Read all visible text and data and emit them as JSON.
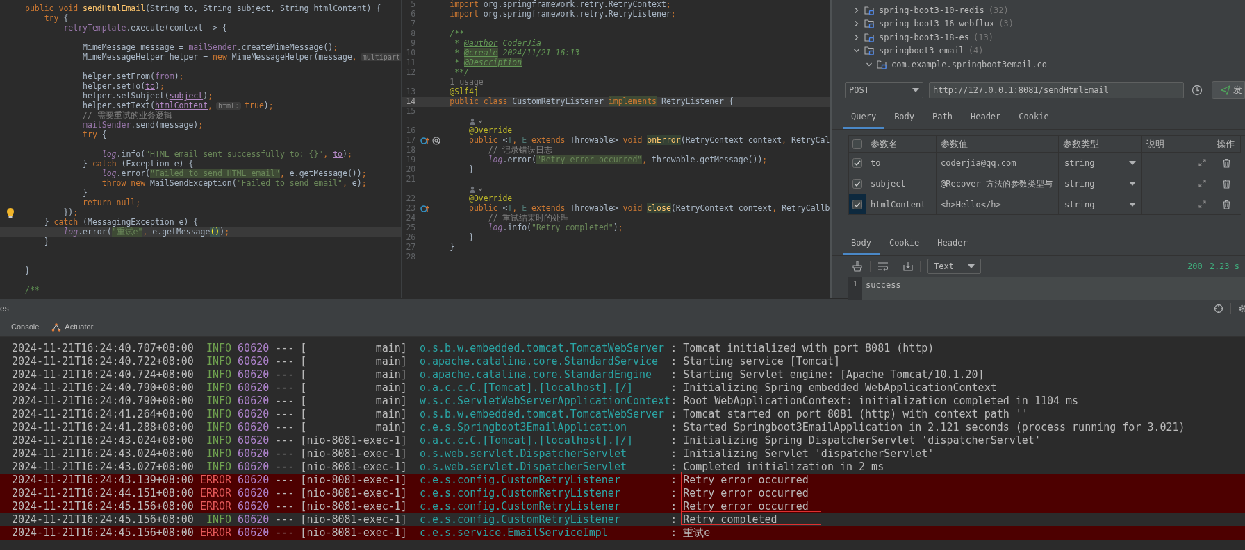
{
  "left_editor": {
    "lines": [
      {
        "current": false,
        "spans": [
          {
            "kind": "kw",
            "text": "public void "
          },
          {
            "kind": "method",
            "text": "sendHtmlEmail"
          },
          {
            "kind": "plain",
            "text": "(String to, String subject, String htmlContent) {"
          }
        ]
      },
      {
        "current": false,
        "spans": [
          {
            "kind": "kw",
            "text": "    try"
          },
          {
            "kind": "plain",
            "text": " {"
          }
        ]
      },
      {
        "current": false,
        "spans": [
          {
            "kind": "field",
            "text": "        retryTemplate"
          },
          {
            "kind": "plain",
            "text": ".execute(context -> {"
          }
        ]
      },
      {
        "current": false
      },
      {
        "current": false,
        "spans": [
          {
            "kind": "plain",
            "text": "            MimeMessage message = "
          },
          {
            "kind": "field",
            "text": "mailSender"
          },
          {
            "kind": "plain",
            "text": ".createMimeMessage()"
          },
          {
            "kind": "kw",
            "text": ";"
          }
        ]
      },
      {
        "current": false,
        "spans": [
          {
            "kind": "plain",
            "text": "            MimeMessageHelper helper = "
          },
          {
            "kind": "kw",
            "text": "new "
          },
          {
            "kind": "plain",
            "text": "MimeMessageHelper(message"
          },
          {
            "kind": "kw",
            "text": ","
          },
          {
            "kind": "hint",
            "text": "multipart"
          }
        ]
      },
      {
        "current": false
      },
      {
        "current": false,
        "spans": [
          {
            "kind": "plain",
            "text": "            helper.setFrom("
          },
          {
            "kind": "field",
            "text": "from"
          },
          {
            "kind": "plain",
            "text": ")"
          },
          {
            "kind": "kw",
            "text": ";"
          }
        ]
      },
      {
        "current": false,
        "spans": [
          {
            "kind": "plain",
            "text": "            helper.setTo("
          },
          {
            "kind": "param",
            "text": "to"
          },
          {
            "kind": "plain",
            "text": ")"
          },
          {
            "kind": "kw",
            "text": ";"
          }
        ]
      },
      {
        "current": false,
        "spans": [
          {
            "kind": "plain",
            "text": "            helper.setSubject("
          },
          {
            "kind": "param",
            "text": "subject"
          },
          {
            "kind": "plain",
            "text": ")"
          },
          {
            "kind": "kw",
            "text": ";"
          }
        ]
      },
      {
        "current": false,
        "spans": [
          {
            "kind": "plain",
            "text": "            helper.setText("
          },
          {
            "kind": "param",
            "text": "htmlContent"
          },
          {
            "kind": "kw",
            "text": ","
          },
          {
            "kind": "hint",
            "text": "html:"
          },
          {
            "kind": "kw",
            "text": "true"
          },
          {
            "kind": "plain",
            "text": ")"
          },
          {
            "kind": "kw",
            "text": ";"
          }
        ]
      },
      {
        "current": false,
        "spans": [
          {
            "kind": "comment",
            "text": "            // 需要重试的业务逻辑"
          }
        ]
      },
      {
        "current": false,
        "spans": [
          {
            "kind": "field",
            "text": "            mailSender"
          },
          {
            "kind": "plain",
            "text": ".send(message)"
          },
          {
            "kind": "kw",
            "text": ";"
          }
        ]
      },
      {
        "current": false,
        "spans": [
          {
            "kind": "kw",
            "text": "            try"
          },
          {
            "kind": "plain",
            "text": " {"
          }
        ]
      },
      {
        "current": false
      },
      {
        "current": false,
        "spans": [
          {
            "kind": "static",
            "text": "                log"
          },
          {
            "kind": "plain",
            "text": ".info("
          },
          {
            "kind": "str",
            "text": "\"HTML email sent successfully to: {}\""
          },
          {
            "kind": "kw",
            "text": ", "
          },
          {
            "kind": "param",
            "text": "to"
          },
          {
            "kind": "plain",
            "text": ")"
          },
          {
            "kind": "kw",
            "text": ";"
          }
        ]
      },
      {
        "current": false,
        "spans": [
          {
            "kind": "plain",
            "text": "            } "
          },
          {
            "kind": "kw",
            "text": "catch"
          },
          {
            "kind": "plain",
            "text": " (Exception e) {"
          }
        ]
      },
      {
        "current": false,
        "spans": [
          {
            "kind": "static",
            "text": "                log"
          },
          {
            "kind": "plain",
            "text": ".error("
          },
          {
            "kind": "strhl",
            "text": "\"Failed to send HTML email\""
          },
          {
            "kind": "kw",
            "text": ", "
          },
          {
            "kind": "plain",
            "text": "e.getMessage())"
          },
          {
            "kind": "kw",
            "text": ";"
          }
        ]
      },
      {
        "current": false,
        "spans": [
          {
            "kind": "kw",
            "text": "                throw new "
          },
          {
            "kind": "plain",
            "text": "MailSendException("
          },
          {
            "kind": "str",
            "text": "\"Failed to send email\""
          },
          {
            "kind": "kw",
            "text": ", "
          },
          {
            "kind": "plain",
            "text": "e)"
          },
          {
            "kind": "kw",
            "text": ";"
          }
        ]
      },
      {
        "current": false,
        "spans": [
          {
            "kind": "plain",
            "text": "            }"
          }
        ]
      },
      {
        "current": false,
        "spans": [
          {
            "kind": "kw",
            "text": "            return null;"
          }
        ]
      },
      {
        "current": false,
        "gutter": [
          {
            "kind": "bulb"
          }
        ],
        "spans": [
          {
            "kind": "plain",
            "text": "        })"
          },
          {
            "kind": "kw",
            "text": ";"
          }
        ]
      },
      {
        "current": false,
        "spans": [
          {
            "kind": "plain",
            "text": "    } "
          },
          {
            "kind": "kw",
            "text": "catch"
          },
          {
            "kind": "plain",
            "text": " (MessagingException e) {"
          }
        ]
      },
      {
        "current": true,
        "spans": [
          {
            "kind": "static",
            "text": "        log"
          },
          {
            "kind": "plain",
            "text": ".error("
          },
          {
            "kind": "strhl",
            "text": "\"重试e\""
          },
          {
            "kind": "kw",
            "text": ", "
          },
          {
            "kind": "plain",
            "text": "e.getMessage"
          },
          {
            "kind": "brace",
            "text": "()"
          },
          {
            "kind": "plain",
            "text": ")"
          },
          {
            "kind": "kw",
            "text": ";"
          }
        ]
      },
      {
        "current": false,
        "spans": [
          {
            "kind": "plain",
            "text": "    }"
          }
        ]
      },
      {
        "current": false
      },
      {
        "current": false
      },
      {
        "current": false,
        "spans": [
          {
            "kind": "plain",
            "text": "}"
          }
        ]
      },
      {
        "current": false
      },
      {
        "current": false,
        "spans": [
          {
            "kind": "doc",
            "text": "/**"
          }
        ]
      }
    ]
  },
  "middle_editor": {
    "lines": [
      {
        "kind": "code",
        "number": "5",
        "current": false,
        "spans": [
          {
            "kind": "kw",
            "text": "import "
          },
          {
            "kind": "plain",
            "text": "org.springframework.retry.RetryContext"
          },
          {
            "kind": "kw",
            "text": ";"
          }
        ]
      },
      {
        "kind": "code",
        "number": "6",
        "current": false,
        "spans": [
          {
            "kind": "kw",
            "text": "import "
          },
          {
            "kind": "plain",
            "text": "org.springframework.retry.RetryListener"
          },
          {
            "kind": "kw",
            "text": ";"
          }
        ]
      },
      {
        "kind": "code",
        "number": "7",
        "current": false
      },
      {
        "kind": "code",
        "number": "8",
        "current": false,
        "spans": [
          {
            "kind": "doc",
            "text": "/**"
          }
        ]
      },
      {
        "kind": "code",
        "number": "9",
        "current": false,
        "spans": [
          {
            "kind": "doc",
            "text": " * "
          },
          {
            "kind": "doctag",
            "text": "@author"
          },
          {
            "kind": "doc",
            "text": " CoderJia"
          }
        ]
      },
      {
        "kind": "code",
        "number": "10",
        "current": false,
        "spans": [
          {
            "kind": "doc",
            "text": " * "
          },
          {
            "kind": "doctaghl",
            "text": "@create"
          },
          {
            "kind": "doc",
            "text": " 2024/11/21 16:13"
          }
        ]
      },
      {
        "kind": "code",
        "number": "11",
        "current": false,
        "spans": [
          {
            "kind": "doc",
            "text": " * "
          },
          {
            "kind": "doctaghl",
            "text": "@Description"
          }
        ]
      },
      {
        "kind": "code",
        "number": "12",
        "current": false,
        "spans": [
          {
            "kind": "doc",
            "text": " **/"
          }
        ]
      },
      {
        "kind": "usage",
        "text": "1 usage"
      },
      {
        "kind": "code",
        "number": "13",
        "current": false,
        "spans": [
          {
            "kind": "annot",
            "text": "@Slf4j"
          }
        ]
      },
      {
        "kind": "code",
        "number": "14",
        "current": true,
        "spans": [
          {
            "kind": "kw",
            "text": "public class "
          },
          {
            "kind": "plain",
            "text": "CustomRetryListener "
          },
          {
            "kind": "kwhl",
            "text": "implements"
          },
          {
            "kind": "plain",
            "text": " RetryListener {"
          }
        ]
      },
      {
        "kind": "code",
        "number": "15",
        "current": false
      },
      {
        "kind": "author"
      },
      {
        "kind": "code",
        "number": "16",
        "current": false,
        "spans": [
          {
            "kind": "annot",
            "text": "    @Override"
          }
        ]
      },
      {
        "kind": "code",
        "number": "17",
        "current": false,
        "gutter": [
          {
            "kind": "override"
          },
          {
            "kind": "at"
          }
        ],
        "spans": [
          {
            "kind": "kw",
            "text": "    public "
          },
          {
            "kind": "plain",
            "text": "<"
          },
          {
            "kind": "typeparam",
            "text": "T"
          },
          {
            "kind": "kw",
            "text": ", "
          },
          {
            "kind": "typeparam",
            "text": "E "
          },
          {
            "kind": "kw",
            "text": "extends "
          },
          {
            "kind": "plain",
            "text": "Throwable> "
          },
          {
            "kind": "kw",
            "text": "void "
          },
          {
            "kind": "methodhl",
            "text": "onError"
          },
          {
            "kind": "plain",
            "text": "(RetryContext context"
          },
          {
            "kind": "kw",
            "text": ", "
          },
          {
            "kind": "plain",
            "text": "RetryCal"
          }
        ]
      },
      {
        "kind": "code",
        "number": "18",
        "current": false,
        "spans": [
          {
            "kind": "comment",
            "text": "        // 记录错误日志"
          }
        ]
      },
      {
        "kind": "code",
        "number": "19",
        "current": false,
        "spans": [
          {
            "kind": "static",
            "text": "        log"
          },
          {
            "kind": "plain",
            "text": ".error("
          },
          {
            "kind": "strhl",
            "text": "\"Retry error occurred\""
          },
          {
            "kind": "kw",
            "text": ", "
          },
          {
            "kind": "plain",
            "text": "throwable.getMessage())"
          },
          {
            "kind": "kw",
            "text": ";"
          }
        ]
      },
      {
        "kind": "code",
        "number": "20",
        "current": false,
        "spans": [
          {
            "kind": "plain",
            "text": "    }"
          }
        ]
      },
      {
        "kind": "code",
        "number": "21",
        "current": false
      },
      {
        "kind": "author"
      },
      {
        "kind": "code",
        "number": "22",
        "current": false,
        "spans": [
          {
            "kind": "annot",
            "text": "    @Override"
          }
        ]
      },
      {
        "kind": "code",
        "number": "23",
        "current": false,
        "gutter": [
          {
            "kind": "override"
          }
        ],
        "spans": [
          {
            "kind": "kw",
            "text": "    public "
          },
          {
            "kind": "plain",
            "text": "<"
          },
          {
            "kind": "typeparam",
            "text": "T"
          },
          {
            "kind": "kw",
            "text": ", "
          },
          {
            "kind": "typeparam",
            "text": "E "
          },
          {
            "kind": "kw",
            "text": "extends "
          },
          {
            "kind": "plain",
            "text": "Throwable> "
          },
          {
            "kind": "kw",
            "text": "void "
          },
          {
            "kind": "methodhl",
            "text": "close"
          },
          {
            "kind": "plain",
            "text": "(RetryContext context"
          },
          {
            "kind": "kw",
            "text": ", "
          },
          {
            "kind": "plain",
            "text": "RetryCallb"
          }
        ]
      },
      {
        "kind": "code",
        "number": "24",
        "current": false,
        "spans": [
          {
            "kind": "comment",
            "text": "        // 重试结束时的处理"
          }
        ]
      },
      {
        "kind": "code",
        "number": "25",
        "current": false,
        "spans": [
          {
            "kind": "static",
            "text": "        log"
          },
          {
            "kind": "plain",
            "text": ".info("
          },
          {
            "kind": "str",
            "text": "\"Retry completed\""
          },
          {
            "kind": "plain",
            "text": ")"
          },
          {
            "kind": "kw",
            "text": ";"
          }
        ]
      },
      {
        "kind": "code",
        "number": "26",
        "current": false,
        "spans": [
          {
            "kind": "plain",
            "text": "    }"
          }
        ]
      },
      {
        "kind": "code",
        "number": "27",
        "current": false,
        "spans": [
          {
            "kind": "plain",
            "text": "}"
          }
        ]
      },
      {
        "kind": "code",
        "number": "28",
        "current": false
      }
    ]
  },
  "api_panel": {
    "tree": [
      {
        "name": "spring-boot3-10-redis",
        "count": "(32)",
        "expanded": false
      },
      {
        "name": "spring-boot3-16-webflux",
        "count": "(3)",
        "expanded": false
      },
      {
        "name": "spring-boot3-18-es",
        "count": "(13)",
        "expanded": false
      },
      {
        "name": "springboot3-email",
        "count": "(4)",
        "expanded": true,
        "children": [
          {
            "name": "com.example.springboot3email.co",
            "expanded": true
          }
        ]
      }
    ],
    "request": {
      "method": "POST",
      "url": "http://127.0.0.1:8081/sendHtmlEmail",
      "send_label": "发"
    },
    "request_tabs": [
      {
        "label": "Query",
        "selected": true
      },
      {
        "label": "Body",
        "selected": false
      },
      {
        "label": "Path",
        "selected": false
      },
      {
        "label": "Header",
        "selected": false
      },
      {
        "label": "Cookie",
        "selected": false
      }
    ],
    "params": {
      "all_checked": false,
      "columns": [
        "参数名",
        "参数值",
        "参数类型",
        "说明",
        "操作"
      ],
      "rows": [
        {
          "checked": true,
          "focused": false,
          "name": "to",
          "value": "coderjia@qq.com",
          "type": "string"
        },
        {
          "checked": true,
          "focused": false,
          "name": "subject",
          "value": "@Recover 方法的参数类型与",
          "type": "string"
        },
        {
          "checked": true,
          "focused": true,
          "name": "htmlContent",
          "value": "<h>Hello</h>",
          "type": "string"
        }
      ]
    },
    "response_tabs": [
      {
        "label": "Body",
        "selected": true
      },
      {
        "label": "Cookie",
        "selected": false
      },
      {
        "label": "Header",
        "selected": false
      }
    ],
    "response": {
      "format": "Text",
      "status": "200",
      "time": "2.23 s",
      "lines": [
        {
          "number": "1",
          "text": "success"
        }
      ]
    }
  },
  "console": {
    "header_label": "es",
    "tabs": [
      {
        "kind": "text",
        "label": "Console"
      },
      {
        "kind": "with_icon",
        "label": "Actuator"
      }
    ],
    "rows": [
      {
        "timestamp": "2024-11-21T16:24:40.707+08:00",
        "severity": "INFO",
        "pid": "60620",
        "separator": "---",
        "thread": "[           main]",
        "logger": "o.s.b.w.embedded.tomcat.TomcatWebServer",
        "colon": ":",
        "message": "Tomcat initialized with port 8081 (http)",
        "boxed": false
      },
      {
        "timestamp": "2024-11-21T16:24:40.722+08:00",
        "severity": "INFO",
        "pid": "60620",
        "separator": "---",
        "thread": "[           main]",
        "logger": "o.apache.catalina.core.StandardService",
        "colon": ":",
        "message": "Starting service [Tomcat]",
        "boxed": false
      },
      {
        "timestamp": "2024-11-21T16:24:40.724+08:00",
        "severity": "INFO",
        "pid": "60620",
        "separator": "---",
        "thread": "[           main]",
        "logger": "o.apache.catalina.core.StandardEngine",
        "colon": ":",
        "message": "Starting Servlet engine: [Apache Tomcat/10.1.20]",
        "boxed": false
      },
      {
        "timestamp": "2024-11-21T16:24:40.790+08:00",
        "severity": "INFO",
        "pid": "60620",
        "separator": "---",
        "thread": "[           main]",
        "logger": "o.a.c.c.C.[Tomcat].[localhost].[/]",
        "colon": ":",
        "message": "Initializing Spring embedded WebApplicationContext",
        "boxed": false
      },
      {
        "timestamp": "2024-11-21T16:24:40.790+08:00",
        "severity": "INFO",
        "pid": "60620",
        "separator": "---",
        "thread": "[           main]",
        "logger": "w.s.c.ServletWebServerApplicationContext",
        "colon": ":",
        "message": "Root WebApplicationContext: initialization completed in 1104 ms",
        "boxed": false
      },
      {
        "timestamp": "2024-11-21T16:24:41.264+08:00",
        "severity": "INFO",
        "pid": "60620",
        "separator": "---",
        "thread": "[           main]",
        "logger": "o.s.b.w.embedded.tomcat.TomcatWebServer",
        "colon": ":",
        "message": "Tomcat started on port 8081 (http) with context path ''",
        "boxed": false
      },
      {
        "timestamp": "2024-11-21T16:24:41.288+08:00",
        "severity": "INFO",
        "pid": "60620",
        "separator": "---",
        "thread": "[           main]",
        "logger": "c.e.s.Springboot3EmailApplication",
        "colon": ":",
        "message": "Started Springboot3EmailApplication in 2.121 seconds (process running for 3.021)",
        "boxed": false
      },
      {
        "timestamp": "2024-11-21T16:24:43.024+08:00",
        "severity": "INFO",
        "pid": "60620",
        "separator": "---",
        "thread": "[nio-8081-exec-1]",
        "logger": "o.a.c.c.C.[Tomcat].[localhost].[/]",
        "colon": ":",
        "message": "Initializing Spring DispatcherServlet 'dispatcherServlet'",
        "boxed": false
      },
      {
        "timestamp": "2024-11-21T16:24:43.024+08:00",
        "severity": "INFO",
        "pid": "60620",
        "separator": "---",
        "thread": "[nio-8081-exec-1]",
        "logger": "o.s.web.servlet.DispatcherServlet",
        "colon": ":",
        "message": "Initializing Servlet 'dispatcherServlet'",
        "boxed": false
      },
      {
        "timestamp": "2024-11-21T16:24:43.027+08:00",
        "severity": "INFO",
        "pid": "60620",
        "separator": "---",
        "thread": "[nio-8081-exec-1]",
        "logger": "o.s.web.servlet.DispatcherServlet",
        "colon": ":",
        "message": "Completed initialization in 2 ms",
        "boxed": false
      },
      {
        "timestamp": "2024-11-21T16:24:43.139+08:00",
        "severity": "ERROR",
        "pid": "60620",
        "separator": "---",
        "thread": "[nio-8081-exec-1]",
        "logger": "c.e.s.config.CustomRetryListener",
        "colon": ":",
        "message": "Retry error occurred",
        "boxed": true
      },
      {
        "timestamp": "2024-11-21T16:24:44.151+08:00",
        "severity": "ERROR",
        "pid": "60620",
        "separator": "---",
        "thread": "[nio-8081-exec-1]",
        "logger": "c.e.s.config.CustomRetryListener",
        "colon": ":",
        "message": "Retry error occurred",
        "boxed": true,
        "box_starts": false
      },
      {
        "timestamp": "2024-11-21T16:24:45.156+08:00",
        "severity": "ERROR",
        "pid": "60620",
        "separator": "---",
        "thread": "[nio-8081-exec-1]",
        "logger": "c.e.s.config.CustomRetryListener",
        "colon": ":",
        "message": "Retry error occurred",
        "boxed": true,
        "box_starts": false
      },
      {
        "timestamp": "2024-11-21T16:24:45.156+08:00",
        "severity": "INFO",
        "pid": "60620",
        "separator": "---",
        "thread": "[nio-8081-exec-1]",
        "logger": "c.e.s.config.CustomRetryListener",
        "colon": ":",
        "message": "Retry completed",
        "boxed": true,
        "box_starts": true
      },
      {
        "timestamp": "2024-11-21T16:24:45.156+08:00",
        "severity": "ERROR",
        "pid": "60620",
        "separator": "---",
        "thread": "[nio-8081-exec-1]",
        "logger": "c.e.s.service.EmailServiceImpl",
        "colon": ":",
        "message": "重试e",
        "boxed": false
      }
    ]
  }
}
